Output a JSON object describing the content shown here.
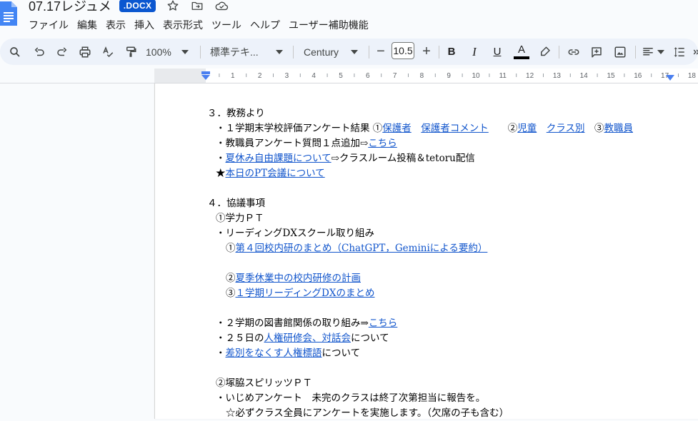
{
  "header": {
    "doc_title": "07.17レジュメ",
    "ext_badge": ".DOCX"
  },
  "menu": [
    "ファイル",
    "編集",
    "表示",
    "挿入",
    "表示形式",
    "ツール",
    "ヘルプ",
    "ユーザー補助機能"
  ],
  "toolbar": {
    "zoom": "100%",
    "style": "標準テキ...",
    "font": "Century",
    "font_size": "10.5",
    "minus": "−",
    "plus": "+",
    "bold": "B",
    "italic": "I",
    "underline": "U",
    "text_color_label": "A"
  },
  "ruler": {
    "ticks": [
      "2",
      "1",
      "1",
      "2",
      "3",
      "4",
      "5",
      "6",
      "7",
      "8",
      "9",
      "10",
      "11",
      "12",
      "13",
      "14",
      "15",
      "16",
      "17",
      "18"
    ]
  },
  "colors": {
    "accent": "#0b57d0",
    "toolbar_bg": "#edf2fa",
    "link": "#1155cc"
  },
  "content": {
    "l1": "３．教務より",
    "l2a": "・１学期末学校評価アンケート結果 ①",
    "l2b": "保護者",
    "l2c": "　",
    "l2d": "保護者コメント",
    "l2e": "　　②",
    "l2f": "児童",
    "l2g": "　",
    "l2h": "クラス別",
    "l2i": "　③",
    "l2j": "教職員",
    "l3a": "・教職員アンケート質問１点追加⇨",
    "l3b": "こちら",
    "l4a": "・",
    "l4b": "夏休み自由課題について",
    "l4c": "⇨クラスルーム投稿＆tetoru配信",
    "l5a": "★",
    "l5b": "本日のPT会議について",
    "l7": "４．協議事項",
    "l8": "①学力ＰＴ",
    "l9": "・リーディングDXスクール取り組み",
    "l10a": "①",
    "l10b": "第４回校内研のまとめ（ChatGPT，Geminiによる要約）",
    "l12a": "②",
    "l12b": "夏季休業中の校内研修の計画",
    "l13a": "③",
    "l13b": "１学期リーディングDXのまとめ",
    "l15a": "・２学期の図書館関係の取り組み⇒",
    "l15b": "こちら",
    "l16a": "・２５日の",
    "l16b": "人権研修会、対話会",
    "l16c": "について",
    "l17a": "・",
    "l17b": "差別をなくす人権標語",
    "l17c": "について",
    "l19": "②塚脇スピリッツＰＴ",
    "l20": "・いじめアンケート　未完のクラスは終了次第担当に報告を。",
    "l21": "☆必ずクラス全員にアンケートを実施します。（欠席の子も含む）"
  }
}
